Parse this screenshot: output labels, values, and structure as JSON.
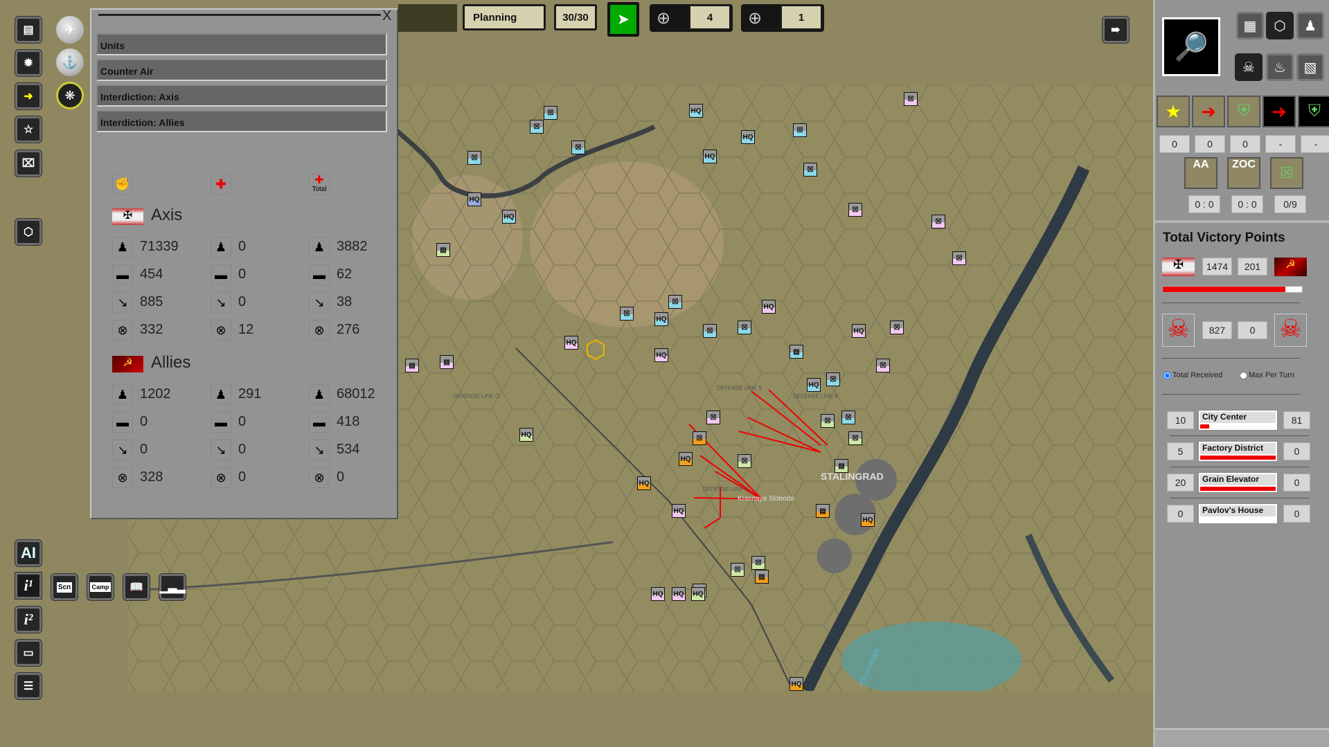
{
  "top_bar": {
    "phase": "Planning",
    "turn": "30/30",
    "air_count": "4",
    "ground_count": "1"
  },
  "panel": {
    "close": "X",
    "menu": [
      "Units",
      "Counter Air",
      "Interdiction: Axis",
      "Interdiction: Allies"
    ],
    "total_label": "Total",
    "sides": [
      {
        "name": "Axis",
        "rows": [
          [
            "71339",
            "0",
            "3882"
          ],
          [
            "454",
            "0",
            "62"
          ],
          [
            "885",
            "0",
            "38"
          ],
          [
            "332",
            "12",
            "276"
          ]
        ]
      },
      {
        "name": "Allies",
        "rows": [
          [
            "1202",
            "291",
            "68012"
          ],
          [
            "0",
            "0",
            "418"
          ],
          [
            "0",
            "0",
            "534"
          ],
          [
            "328",
            "0",
            "0"
          ]
        ]
      }
    ]
  },
  "left_toolbar": {
    "ai": "AI",
    "scn": "Scn",
    "camp": "Camp"
  },
  "right_panel": {
    "unit_counts": [
      "0",
      "0",
      "0",
      "-",
      "-"
    ],
    "aa_label": "AA",
    "zoc_label": "ZOC",
    "aa_value": "0 : 0",
    "zoc_value": "0 : 0",
    "stack_value": "0/9",
    "vp_title": "Total Victory Points",
    "axis_vp": "1474",
    "allies_vp": "201",
    "vp_fraction": 0.88,
    "axis_losses": "827",
    "allies_losses": "0",
    "radio_total": "Total Received",
    "radio_max": "Max Per Turn",
    "objectives": [
      {
        "left": "10",
        "name": "City Center",
        "right": "81",
        "fill": 0.12
      },
      {
        "left": "5",
        "name": "Factory District",
        "right": "0",
        "fill": 1
      },
      {
        "left": "20",
        "name": "Grain Elevator",
        "right": "0",
        "fill": 1
      },
      {
        "left": "0",
        "name": "Pavlov's House",
        "right": "0",
        "fill": 0
      }
    ]
  },
  "map": {
    "hq": "HQ",
    "city": "STALINGRAD",
    "river": "VOLGA RIVER",
    "line_s": "DEFENSE LINE S",
    "line_k": "DEFENSE LINE K",
    "line_o": "DEFENSE LINE O",
    "sloboda": "Krasnaya Sloboda",
    "colors": {
      "axis": "#8fd8e8",
      "allies": "#f2c8f0",
      "allies2": "#cfe8a8",
      "orange": "#f0a020"
    }
  }
}
